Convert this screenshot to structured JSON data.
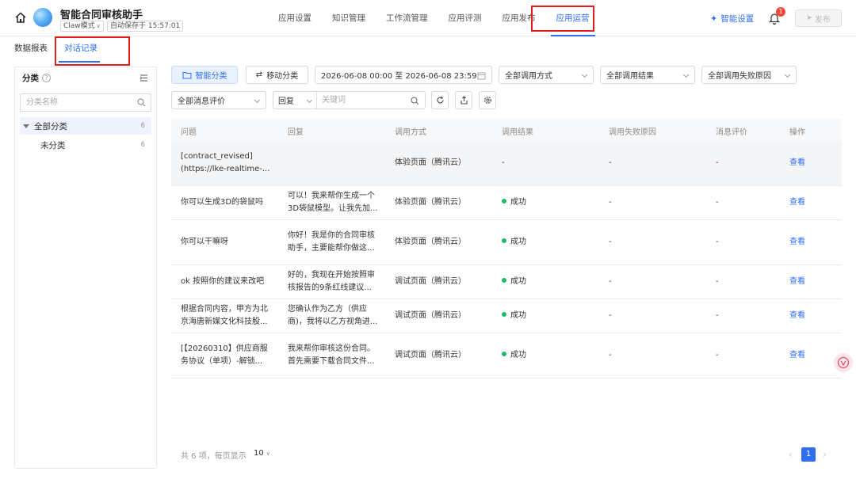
{
  "header": {
    "app_title": "智能合同审核助手",
    "mode": "Claw模式",
    "autosave": "自动保存于 15:57:01",
    "nav": [
      "应用设置",
      "知识管理",
      "工作流管理",
      "应用评测",
      "应用发布",
      "应用运营"
    ],
    "active_nav_index": 5,
    "smart_settings": "智能设置",
    "notification_count": "1",
    "publish": "发布"
  },
  "sub_tabs": [
    "数据报表",
    "对话记录"
  ],
  "sidebar": {
    "title": "分类",
    "search_placeholder": "分类名称",
    "items": [
      {
        "label": "全部分类",
        "count": "6"
      },
      {
        "label": "未分类",
        "count": "6"
      }
    ]
  },
  "filters": {
    "smart_category": "智能分类",
    "move_category": "移动分类",
    "date_range": "2026-06-08 00:00 至 2026-06-08 23:59",
    "call_method": "全部调用方式",
    "call_result": "全部调用结果",
    "fail_reason": "全部调用失败原因",
    "message_rating": "全部消息评价",
    "search_field": "回复",
    "keyword_placeholder": "关键词"
  },
  "table": {
    "columns": [
      "问题",
      "回复",
      "调用方式",
      "调用结果",
      "调用失败原因",
      "消息评价",
      "操作"
    ],
    "rows": [
      {
        "q1": "[contract_revised]",
        "q2": "(https://lke-realtime-...",
        "a1": "",
        "a2": "",
        "method": "体验页面（腾讯云）",
        "result": "-",
        "fail": "-",
        "rating": "-",
        "action": "查看"
      },
      {
        "q1": "你可以生成3D的袋鼠吗",
        "q2": "",
        "a1": "可以！我来帮你生成一个",
        "a2": "3D袋鼠模型。让我先加...",
        "method": "体验页面（腾讯云）",
        "result": "成功",
        "fail": "-",
        "rating": "-",
        "action": "查看"
      },
      {
        "q1": "你可以干嘛呀",
        "q2": "",
        "a1": "你好！我是你的合同审核",
        "a2": "助手，主要能帮你做这...",
        "method": "体验页面（腾讯云）",
        "result": "成功",
        "fail": "-",
        "rating": "-",
        "action": "查看"
      },
      {
        "q1": "ok 按照你的建议来改吧",
        "q2": "",
        "a1": "好的，我现在开始按照审",
        "a2": "核报告的9条红线建议...",
        "method": "调试页面（腾讯云）",
        "result": "成功",
        "fail": "-",
        "rating": "-",
        "action": "查看"
      },
      {
        "q1": "根据合同内容，甲方为北",
        "q2": "京海唐新媒文化科技股...",
        "a1": "您确认作为乙方（供应",
        "a2": "商)，我将以乙方视角进...",
        "method": "调试页面（腾讯云）",
        "result": "成功",
        "fail": "-",
        "rating": "-",
        "action": "查看"
      },
      {
        "q1": "[【20260310】供应商服",
        "q2": "务协议（单项）-解锁...",
        "a1": "我来帮你审核这份合同。",
        "a2": "首先需要下载合同文件...",
        "method": "调试页面（腾讯云）",
        "result": "成功",
        "fail": "-",
        "rating": "-",
        "action": "查看"
      }
    ]
  },
  "pagination": {
    "summary": "共 6 项，每页显示",
    "page_size": "10",
    "current_page": "1"
  },
  "colors": {
    "accent": "#2f6ff5",
    "success": "#1fb86a",
    "highlight_box": "#e02020"
  }
}
